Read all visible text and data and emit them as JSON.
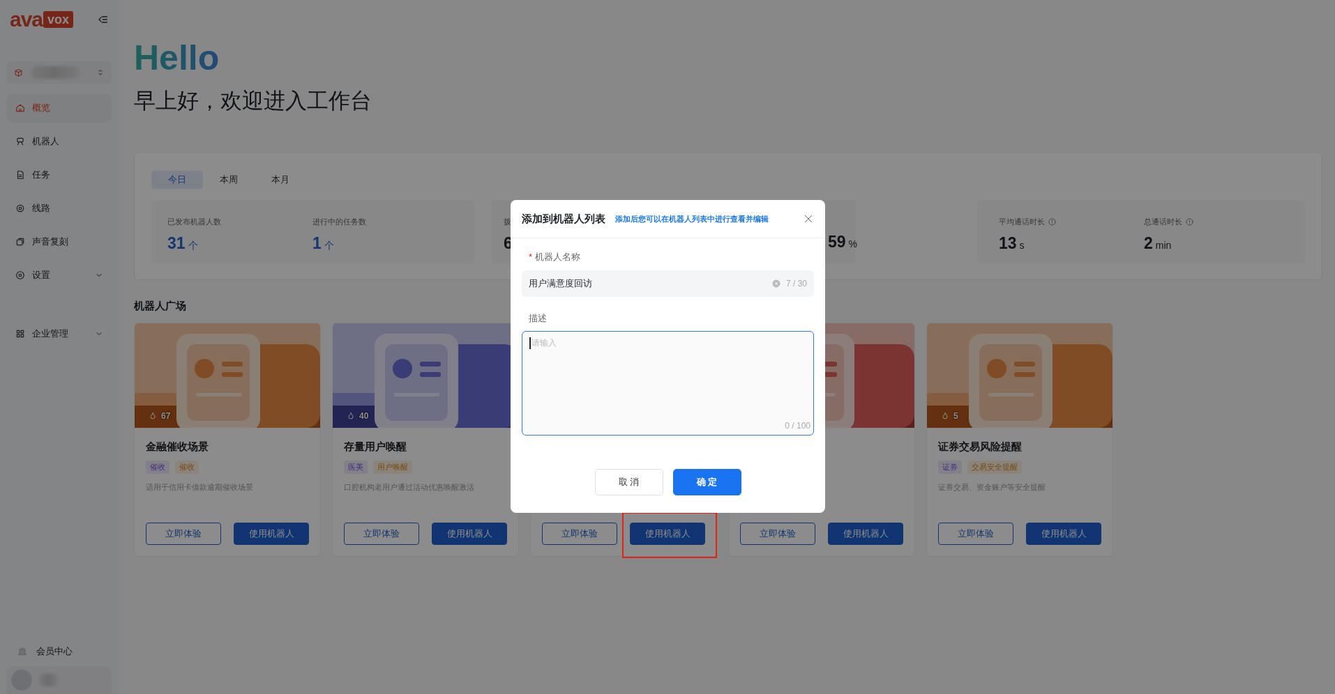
{
  "sidebar": {
    "logo": {
      "text": "ava",
      "badge": "vox"
    },
    "nav": [
      {
        "label": "概览",
        "selected": true,
        "expandable": false
      },
      {
        "label": "机器人",
        "selected": false,
        "expandable": false
      },
      {
        "label": "任务",
        "selected": false,
        "expandable": false
      },
      {
        "label": "线路",
        "selected": false,
        "expandable": false
      },
      {
        "label": "声音复刻",
        "selected": false,
        "expandable": false
      },
      {
        "label": "设置",
        "selected": false,
        "expandable": true
      },
      {
        "label": "企业管理",
        "selected": false,
        "expandable": true
      }
    ],
    "footer": {
      "label": "会员中心"
    }
  },
  "header": {
    "greeting": "Hello",
    "subtitle": "早上好，欢迎进入工作台"
  },
  "stats": {
    "tabs": [
      {
        "label": "今日",
        "selected": true
      },
      {
        "label": "本周",
        "selected": false
      },
      {
        "label": "本月",
        "selected": false
      }
    ],
    "groups": [
      {
        "stats": [
          {
            "label": "已发布机器人数",
            "value": "31",
            "unit": "个",
            "accent": true
          },
          {
            "label": "进行中的任务数",
            "value": "1",
            "unit": "个",
            "accent": true
          }
        ]
      },
      {
        "stats": [
          {
            "label": "拨",
            "value": "6",
            "accent": false
          }
        ]
      },
      {
        "stats": [
          {
            "value": "59",
            "unit": "%",
            "accent": false
          }
        ]
      },
      {
        "stats": [
          {
            "label": "平均通话时长",
            "value": "13",
            "unit": "s",
            "accent": false,
            "info": true
          },
          {
            "label": "总通话时长",
            "value": "2",
            "unit": "min",
            "accent": false,
            "info": true
          }
        ]
      }
    ]
  },
  "plaza": {
    "title": "机器人广场",
    "cards": [
      {
        "kind": "finance",
        "likes": "67",
        "title": "金融催收场景",
        "tags": [
          {
            "label": "催收",
            "kind": "industry"
          },
          {
            "label": "催收",
            "kind": "scene"
          }
        ],
        "description": "适用于信用卡借款逾期催收场景",
        "try": "立即体验",
        "use": "使用机器人"
      },
      {
        "kind": "dental",
        "likes": "40",
        "title": "存量用户唤醒",
        "tags": [
          {
            "label": "医美",
            "kind": "industry"
          },
          {
            "label": "用户唤醒",
            "kind": "scene"
          }
        ],
        "description": "口腔机构老用户通过活动优惠唤醒激活",
        "try": "立即体验",
        "use": "使用机器人"
      },
      {
        "try": "立即体验",
        "use": "使用机器人",
        "highlighted": true
      },
      {
        "kind": "coral",
        "try": "立即体验",
        "use": "使用机器人"
      },
      {
        "kind": "finance",
        "likes": "5",
        "title": "证券交易风险提醒",
        "tags": [
          {
            "label": "证券",
            "kind": "industry"
          },
          {
            "label": "交易安全提醒",
            "kind": "scene"
          }
        ],
        "description": "证券交易、资金账户等安全提醒",
        "try": "立即体验",
        "use": "使用机器人"
      }
    ]
  },
  "dialog": {
    "title": "添加到机器人列表",
    "hint": "添加后您可以在机器人列表中进行查看并编辑",
    "name_field": {
      "label": "机器人名称",
      "required_mark": "*",
      "value": "用户满意度回访",
      "count": "7 / 30"
    },
    "description_field": {
      "label": "描述",
      "placeholder": "请输入",
      "count": "0 / 100",
      "focused": true
    },
    "cancel": "取 消",
    "confirm": "确 定"
  }
}
